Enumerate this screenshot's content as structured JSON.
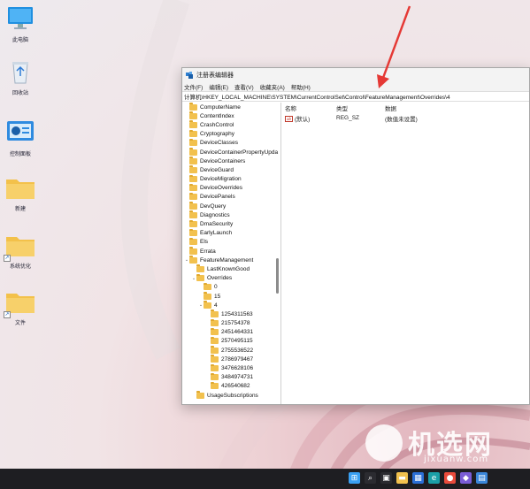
{
  "desktop": {
    "icons": [
      {
        "label": "此电脑",
        "icon": "computer-icon"
      },
      {
        "label": "回收站",
        "icon": "recycle-bin-icon"
      },
      {
        "label": "控制面板",
        "icon": "control-panel-icon"
      },
      {
        "label": "新建",
        "icon": "folder-icon"
      },
      {
        "label": "系统优化",
        "icon": "folder-shortcut-icon"
      },
      {
        "label": "文件",
        "icon": "folder-shortcut-icon"
      }
    ]
  },
  "regedit": {
    "title": "注册表编辑器",
    "menu": [
      "文件(F)",
      "编辑(E)",
      "查看(V)",
      "收藏夹(A)",
      "帮助(H)"
    ],
    "address": "计算机\\HKEY_LOCAL_MACHINE\\SYSTEM\\CurrentControlSet\\Control\\FeatureManagement\\Overrides\\4",
    "tree": [
      {
        "label": "ComputerName",
        "depth": 0
      },
      {
        "label": "ContentIndex",
        "depth": 0
      },
      {
        "label": "CrashControl",
        "depth": 0
      },
      {
        "label": "Cryptography",
        "depth": 0
      },
      {
        "label": "DeviceClasses",
        "depth": 0
      },
      {
        "label": "DeviceContainerPropertyUpda",
        "depth": 0
      },
      {
        "label": "DeviceContainers",
        "depth": 0
      },
      {
        "label": "DeviceGuard",
        "depth": 0
      },
      {
        "label": "DeviceMigration",
        "depth": 0
      },
      {
        "label": "DeviceOverrides",
        "depth": 0
      },
      {
        "label": "DevicePanels",
        "depth": 0
      },
      {
        "label": "DevQuery",
        "depth": 0
      },
      {
        "label": "Diagnostics",
        "depth": 0
      },
      {
        "label": "DmaSecurity",
        "depth": 0
      },
      {
        "label": "EarlyLaunch",
        "depth": 0
      },
      {
        "label": "Els",
        "depth": 0
      },
      {
        "label": "Errata",
        "depth": 0
      },
      {
        "label": "FeatureManagement",
        "depth": 0,
        "twisty": "v"
      },
      {
        "label": "LastKnownGood",
        "depth": 1
      },
      {
        "label": "Overrides",
        "depth": 1,
        "twisty": "v"
      },
      {
        "label": "0",
        "depth": 2
      },
      {
        "label": "15",
        "depth": 2
      },
      {
        "label": "4",
        "depth": 2,
        "twisty": "v"
      },
      {
        "label": "1254311563",
        "depth": 3
      },
      {
        "label": "215754378",
        "depth": 3
      },
      {
        "label": "2451464331",
        "depth": 3
      },
      {
        "label": "2570495115",
        "depth": 3
      },
      {
        "label": "2755536522",
        "depth": 3
      },
      {
        "label": "2786979467",
        "depth": 3
      },
      {
        "label": "3476628106",
        "depth": 3
      },
      {
        "label": "3484974731",
        "depth": 3
      },
      {
        "label": "426540682",
        "depth": 3
      },
      {
        "label": "UsageSubscriptions",
        "depth": 1
      }
    ],
    "columns": [
      "名称",
      "类型",
      "数据"
    ],
    "values": [
      {
        "name": "(默认)",
        "type": "REG_SZ",
        "data": "(数值未设置)"
      }
    ]
  },
  "watermark": {
    "cn": "机选网",
    "url": "jixuanw.com"
  },
  "taskbar": {
    "icons": [
      "windows-start-icon",
      "search-icon",
      "task-view-icon",
      "file-explorer-icon",
      "store-icon",
      "edge-icon",
      "chrome-icon",
      "app-icon",
      "regedit-icon"
    ]
  },
  "colors": {
    "accent_arrow": "#e53935",
    "folder": "#f2c14e",
    "taskbar": "#1e1e22"
  }
}
